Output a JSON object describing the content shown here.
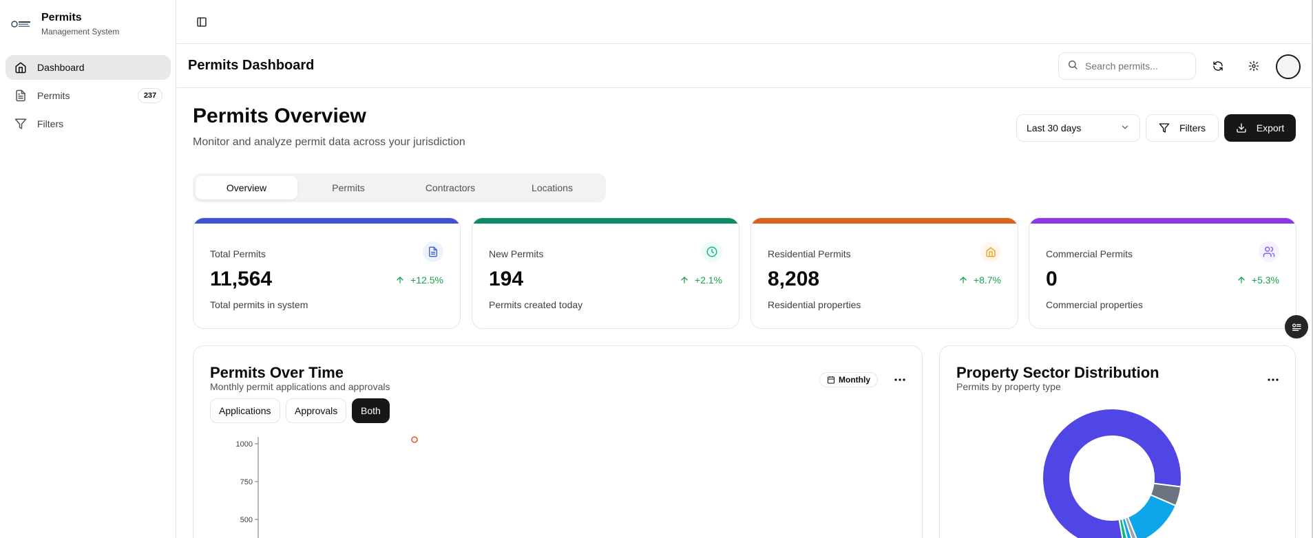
{
  "brand": {
    "title": "Permits",
    "subtitle": "Management System",
    "logo_icon": "company-logo-icon"
  },
  "sidebar": {
    "items": [
      {
        "label": "Dashboard",
        "icon": "home-icon",
        "active": true
      },
      {
        "label": "Permits",
        "icon": "document-icon",
        "badge": "237"
      },
      {
        "label": "Filters",
        "icon": "funnel-icon"
      }
    ]
  },
  "header": {
    "title": "Permits Dashboard",
    "search_placeholder": "Search permits...",
    "icons": [
      "refresh-icon",
      "gear-icon",
      "avatar"
    ]
  },
  "overview": {
    "title": "Permits Overview",
    "subtitle": "Monitor and analyze permit data across your jurisdiction",
    "range": "Last 30 days",
    "filters_label": "Filters",
    "export_label": "Export"
  },
  "tabs": [
    {
      "label": "Overview",
      "active": true
    },
    {
      "label": "Permits"
    },
    {
      "label": "Contractors"
    },
    {
      "label": "Locations"
    }
  ],
  "stats": [
    {
      "label": "Total Permits",
      "value": "11,564",
      "change": "+12.5%",
      "desc": "Total permits in system",
      "color": "#4051d8",
      "icon": "document-icon"
    },
    {
      "label": "New Permits",
      "value": "194",
      "change": "+2.1%",
      "desc": "Permits created today",
      "color": "#0f8a68",
      "icon": "clock-icon"
    },
    {
      "label": "Residential Permits",
      "value": "8,208",
      "change": "+8.7%",
      "desc": "Residential properties",
      "color": "#d9631a",
      "icon": "house-icon"
    },
    {
      "label": "Commercial Permits",
      "value": "0",
      "change": "+5.3%",
      "desc": "Commercial properties",
      "color": "#8a38e8",
      "icon": "users-icon"
    }
  ],
  "permits_over_time": {
    "title": "Permits Over Time",
    "subtitle": "Monthly permit applications and approvals",
    "period": "Monthly",
    "toggles": [
      {
        "label": "Applications"
      },
      {
        "label": "Approvals"
      },
      {
        "label": "Both",
        "active": true
      }
    ],
    "chart_data": {
      "type": "line",
      "y_ticks": [
        "1000",
        "750",
        "500"
      ],
      "ylim": [
        0,
        1000
      ],
      "points": [
        {
          "y": 1000
        }
      ]
    }
  },
  "sector_distribution": {
    "title": "Property Sector Distribution",
    "subtitle": "Permits by property type",
    "chart_data": {
      "type": "pie",
      "slices": [
        {
          "value": 71,
          "color": "#4f46e5"
        },
        {
          "value": 4,
          "color": "#6b7280"
        },
        {
          "value": 11,
          "color": "#0ea5e9"
        },
        {
          "value": 1,
          "color": "#9ca3af"
        },
        {
          "value": 1,
          "color": "#0ea5e9"
        },
        {
          "value": 1,
          "color": "#10b981"
        }
      ]
    }
  }
}
